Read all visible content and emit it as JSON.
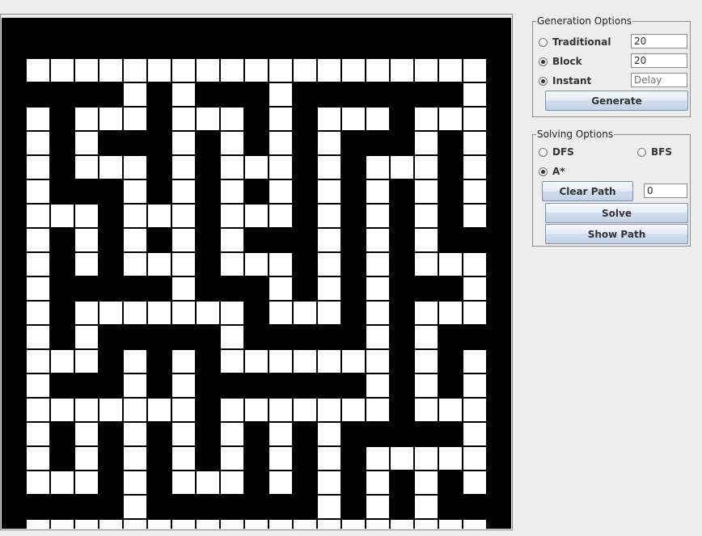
{
  "maze": {
    "rows": [
      "#####################",
      "#...................#",
      "#####.#.###.#######.#",
      "#.#...#...#.#...#...#",
      "#.#.###.#.#.#.###.#.#",
      "#.#...#.#...#.#...#.#",
      "#.###.#.#.#.#.#.#.#.#",
      "#...#...#...#.#.#.#.#",
      "#.#.#.#.#.###.#.#.###",
      "#.#.#...#...#.#.#...#",
      "#.#####.###.#.#.###.#",
      "#.#.......#...#.#...#",
      "#.#.#####.#####.#.###",
      "#...#.#.#.......#.#.#",
      "#.###.#.#######.#.#.#",
      "#.......#.......#...#",
      "#.#.#.#.#.#.#.#####.#",
      "#.#.#.#.#.#.#.#.....#",
      "#...#.#...#.#.#.#.#.#",
      "#####.#######.#.#.###",
      "#...................#",
      "#####################"
    ],
    "wall_color": "#000000",
    "path_color": "#ffffff"
  },
  "generation": {
    "title": "Generation Options",
    "options": [
      {
        "label": "Traditional",
        "selected": false
      },
      {
        "label": "Block",
        "selected": true
      },
      {
        "label": "Instant",
        "selected": true
      }
    ],
    "size_value": "20",
    "block_value": "20",
    "delay_value": "Delay",
    "generate_label": "Generate"
  },
  "solving": {
    "title": "Solving Options",
    "options": [
      {
        "label": "DFS",
        "selected": false
      },
      {
        "label": "BFS",
        "selected": false
      },
      {
        "label": "A*",
        "selected": true
      }
    ],
    "clear_label": "Clear Path",
    "path_value": "0",
    "solve_label": "Solve",
    "show_path_label": "Show Path"
  }
}
